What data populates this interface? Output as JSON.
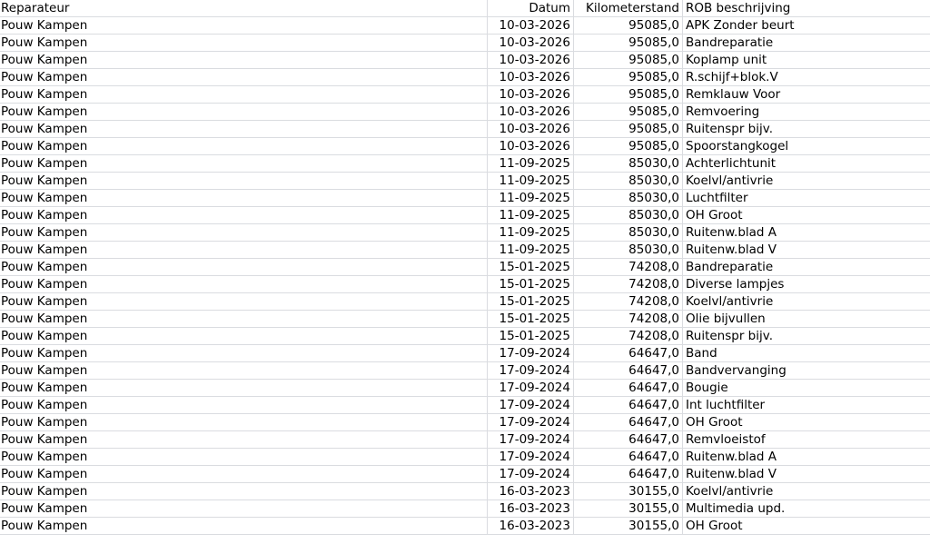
{
  "columns": {
    "reparateur": "Reparateur",
    "datum": "Datum",
    "kilometerstand": "Kilometerstand",
    "rob": "ROB beschrijving"
  },
  "rows": [
    {
      "reparateur": "Pouw Kampen",
      "datum": "10-03-2026",
      "km": "95085,0",
      "rob": "APK Zonder beurt"
    },
    {
      "reparateur": "Pouw Kampen",
      "datum": "10-03-2026",
      "km": "95085,0",
      "rob": "Bandreparatie"
    },
    {
      "reparateur": "Pouw Kampen",
      "datum": "10-03-2026",
      "km": "95085,0",
      "rob": "Koplamp unit"
    },
    {
      "reparateur": "Pouw Kampen",
      "datum": "10-03-2026",
      "km": "95085,0",
      "rob": "R.schijf+blok.V"
    },
    {
      "reparateur": "Pouw Kampen",
      "datum": "10-03-2026",
      "km": "95085,0",
      "rob": "Remklauw Voor"
    },
    {
      "reparateur": "Pouw Kampen",
      "datum": "10-03-2026",
      "km": "95085,0",
      "rob": "Remvoering"
    },
    {
      "reparateur": "Pouw Kampen",
      "datum": "10-03-2026",
      "km": "95085,0",
      "rob": "Ruitenspr bijv."
    },
    {
      "reparateur": "Pouw Kampen",
      "datum": "10-03-2026",
      "km": "95085,0",
      "rob": "Spoorstangkogel"
    },
    {
      "reparateur": "Pouw Kampen",
      "datum": "11-09-2025",
      "km": "85030,0",
      "rob": "Achterlichtunit"
    },
    {
      "reparateur": "Pouw Kampen",
      "datum": "11-09-2025",
      "km": "85030,0",
      "rob": "Koelvl/antivrie"
    },
    {
      "reparateur": "Pouw Kampen",
      "datum": "11-09-2025",
      "km": "85030,0",
      "rob": "Luchtfilter"
    },
    {
      "reparateur": "Pouw Kampen",
      "datum": "11-09-2025",
      "km": "85030,0",
      "rob": "OH Groot"
    },
    {
      "reparateur": "Pouw Kampen",
      "datum": "11-09-2025",
      "km": "85030,0",
      "rob": "Ruitenw.blad A"
    },
    {
      "reparateur": "Pouw Kampen",
      "datum": "11-09-2025",
      "km": "85030,0",
      "rob": "Ruitenw.blad V"
    },
    {
      "reparateur": "Pouw Kampen",
      "datum": "15-01-2025",
      "km": "74208,0",
      "rob": "Bandreparatie"
    },
    {
      "reparateur": "Pouw Kampen",
      "datum": "15-01-2025",
      "km": "74208,0",
      "rob": "Diverse lampjes"
    },
    {
      "reparateur": "Pouw Kampen",
      "datum": "15-01-2025",
      "km": "74208,0",
      "rob": "Koelvl/antivrie"
    },
    {
      "reparateur": "Pouw Kampen",
      "datum": "15-01-2025",
      "km": "74208,0",
      "rob": "Olie bijvullen"
    },
    {
      "reparateur": "Pouw Kampen",
      "datum": "15-01-2025",
      "km": "74208,0",
      "rob": "Ruitenspr bijv."
    },
    {
      "reparateur": "Pouw Kampen",
      "datum": "17-09-2024",
      "km": "64647,0",
      "rob": "Band"
    },
    {
      "reparateur": "Pouw Kampen",
      "datum": "17-09-2024",
      "km": "64647,0",
      "rob": "Bandvervanging"
    },
    {
      "reparateur": "Pouw Kampen",
      "datum": "17-09-2024",
      "km": "64647,0",
      "rob": "Bougie"
    },
    {
      "reparateur": "Pouw Kampen",
      "datum": "17-09-2024",
      "km": "64647,0",
      "rob": "Int luchtfilter"
    },
    {
      "reparateur": "Pouw Kampen",
      "datum": "17-09-2024",
      "km": "64647,0",
      "rob": "OH Groot"
    },
    {
      "reparateur": "Pouw Kampen",
      "datum": "17-09-2024",
      "km": "64647,0",
      "rob": "Remvloeistof"
    },
    {
      "reparateur": "Pouw Kampen",
      "datum": "17-09-2024",
      "km": "64647,0",
      "rob": "Ruitenw.blad A"
    },
    {
      "reparateur": "Pouw Kampen",
      "datum": "17-09-2024",
      "km": "64647,0",
      "rob": "Ruitenw.blad V"
    },
    {
      "reparateur": "Pouw Kampen",
      "datum": "16-03-2023",
      "km": "30155,0",
      "rob": "Koelvl/antivrie"
    },
    {
      "reparateur": "Pouw Kampen",
      "datum": "16-03-2023",
      "km": "30155,0",
      "rob": "Multimedia upd."
    },
    {
      "reparateur": "Pouw Kampen",
      "datum": "16-03-2023",
      "km": "30155,0",
      "rob": "OH Groot"
    }
  ]
}
